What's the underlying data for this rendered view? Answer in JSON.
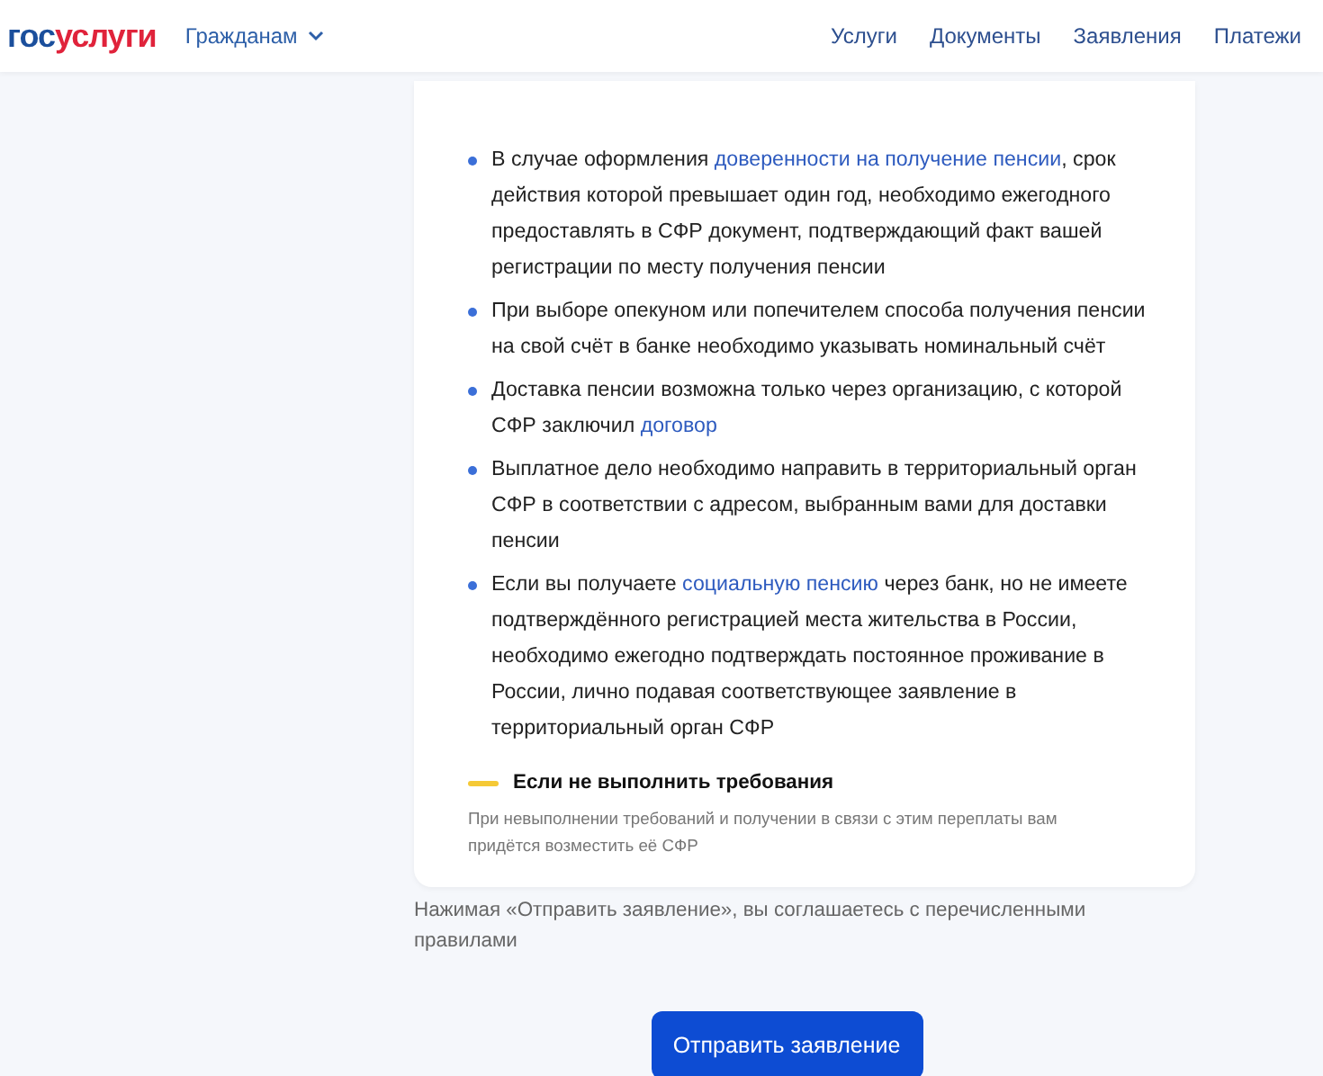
{
  "header": {
    "logo": {
      "part_1": "гос",
      "part_2": "услуги"
    },
    "menu": {
      "label": "Гражданам",
      "expanded": false
    },
    "nav": [
      "Услуги",
      "Документы",
      "Заявления",
      "Платежи"
    ]
  },
  "card": {
    "items": [
      [
        {
          "text": "В случае оформления "
        },
        {
          "text": "доверенности на получение пенсии",
          "link": true
        },
        {
          "text": ", срок действия которой превышает один год, необходимо ежегодного предоставлять в СФР документ, подтверждающий факт вашей регистрации по месту получения пенсии"
        }
      ],
      [
        {
          "text": "При выборе опекуном или попечителем способа получения пенсии на свой счёт в банке необходимо указывать номинальный счёт"
        }
      ],
      [
        {
          "text": "Доставка пенсии возможна только через организацию, с которой СФР заключил "
        },
        {
          "text": "договор",
          "link": true
        }
      ],
      [
        {
          "text": "Выплатное дело необходимо направить в территориальный орган СФР в соответствии с адресом, выбранным вами для доставки пенсии"
        }
      ],
      [
        {
          "text": "Если вы получаете "
        },
        {
          "text": "социальную пенсию",
          "link": true
        },
        {
          "text": " через банк, но не имеете подтверждённого регистрацией места жительства в России, необходимо ежегодно подтверждать постоянное проживание в России, лично подавая соответствующее заявление в территориальный орган СФР"
        }
      ]
    ],
    "warning": {
      "title": "Если не выполнить требования",
      "text": "При невыполнении требований и получении в связи с этим переплаты вам придётся возместить её СФР"
    }
  },
  "agreement": "Нажимая «Отправить заявление», вы соглашаетесь с перечисленными правилами",
  "submit": "Отправить заявление"
}
